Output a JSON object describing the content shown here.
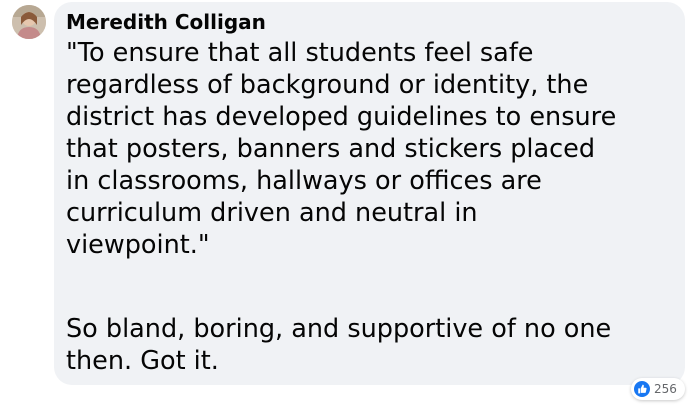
{
  "comment": {
    "author": "Meredith Colligan",
    "paragraphs": [
      {
        "lines": [
          "\"To ensure that all students feel safe",
          "regardless of background or identity, the",
          "district has developed guidelines to ensure",
          "that posters, banners and stickers placed",
          "in classrooms, hallways or offices are",
          "curriculum driven and neutral in",
          "viewpoint.\""
        ]
      },
      {
        "lines": [
          "So bland, boring, and supportive of no one",
          "then. Got it."
        ]
      }
    ],
    "reactions": {
      "icon": "like-icon",
      "count": "256"
    }
  },
  "colors": {
    "bubble_bg": "#f0f2f5",
    "text": "#050505",
    "like_blue": "#1877f2",
    "count_gray": "#65676b"
  }
}
